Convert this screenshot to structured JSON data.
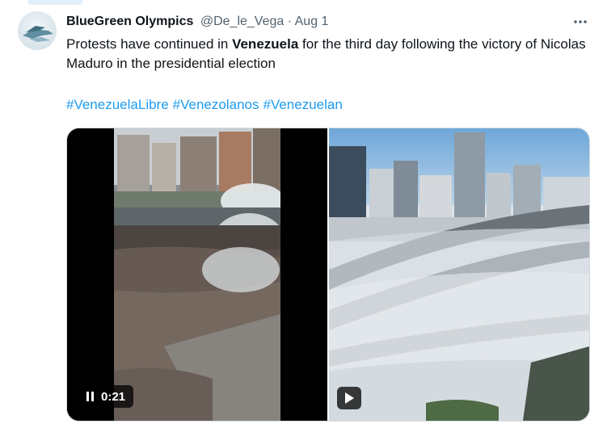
{
  "author": {
    "name": "BlueGreen Olympics",
    "handle": "@De_le_Vega",
    "separator": "·",
    "date": "Aug 1"
  },
  "tweet": {
    "text_before": "Protests have continued in ",
    "text_bold": "Venezuela",
    "text_after": " for the third day following the victory of Nicolas Maduro in the presidential election",
    "hashtags": [
      "#VenezuelaLibre",
      "#Venezolanos",
      "#Venezuelan"
    ]
  },
  "media": [
    {
      "type": "video",
      "state": "paused-icon",
      "duration": "0:21"
    },
    {
      "type": "video",
      "state": "play-icon"
    }
  ],
  "icons": {
    "more": "more-horizontal-icon",
    "pause": "pause-icon",
    "play": "play-icon"
  },
  "colors": {
    "link": "#1d9bf0",
    "secondary": "#536471",
    "text": "#0f1419"
  }
}
